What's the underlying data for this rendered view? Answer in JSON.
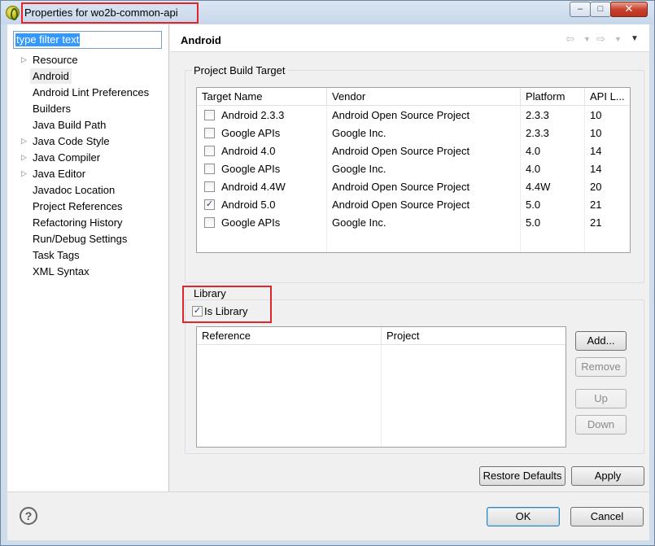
{
  "window": {
    "title": "Properties for wo2b-common-api",
    "minimize_glyph": "‒",
    "maximize_glyph": "□",
    "close_glyph": "✕"
  },
  "filter": {
    "value": "type filter text"
  },
  "tree": [
    {
      "label": "Resource",
      "expandable": true
    },
    {
      "label": "Android",
      "expandable": false,
      "selected": true
    },
    {
      "label": "Android Lint Preferences",
      "expandable": false
    },
    {
      "label": "Builders",
      "expandable": false
    },
    {
      "label": "Java Build Path",
      "expandable": false
    },
    {
      "label": "Java Code Style",
      "expandable": true
    },
    {
      "label": "Java Compiler",
      "expandable": true
    },
    {
      "label": "Java Editor",
      "expandable": true
    },
    {
      "label": "Javadoc Location",
      "expandable": false
    },
    {
      "label": "Project References",
      "expandable": false
    },
    {
      "label": "Refactoring History",
      "expandable": false
    },
    {
      "label": "Run/Debug Settings",
      "expandable": false
    },
    {
      "label": "Task Tags",
      "expandable": false
    },
    {
      "label": "XML Syntax",
      "expandable": false
    }
  ],
  "page": {
    "title": "Android",
    "back_icon": "back-arrow-icon",
    "forward_icon": "forward-arrow-icon",
    "menu_icon": "view-menu-icon"
  },
  "build_target": {
    "label": "Project Build Target",
    "columns": [
      "Target Name",
      "Vendor",
      "Platform",
      "API L..."
    ],
    "rows": [
      {
        "name": "Android 2.3.3",
        "vendor": "Android Open Source Project",
        "platform": "2.3.3",
        "api": "10",
        "checked": false
      },
      {
        "name": "Google APIs",
        "vendor": "Google Inc.",
        "platform": "2.3.3",
        "api": "10",
        "checked": false
      },
      {
        "name": "Android 4.0",
        "vendor": "Android Open Source Project",
        "platform": "4.0",
        "api": "14",
        "checked": false
      },
      {
        "name": "Google APIs",
        "vendor": "Google Inc.",
        "platform": "4.0",
        "api": "14",
        "checked": false
      },
      {
        "name": "Android 4.4W",
        "vendor": "Android Open Source Project",
        "platform": "4.4W",
        "api": "20",
        "checked": false
      },
      {
        "name": "Android 5.0",
        "vendor": "Android Open Source Project",
        "platform": "5.0",
        "api": "21",
        "checked": true
      },
      {
        "name": "Google APIs",
        "vendor": "Google Inc.",
        "platform": "5.0",
        "api": "21",
        "checked": false
      }
    ]
  },
  "library": {
    "label": "Library",
    "is_library_label": "Is Library",
    "is_library_checked": true,
    "columns": [
      "Reference",
      "Project"
    ],
    "buttons": {
      "add": "Add...",
      "remove": "Remove",
      "up": "Up",
      "down": "Down"
    }
  },
  "footer": {
    "restore_defaults": "Restore Defaults",
    "apply": "Apply",
    "ok": "OK",
    "cancel": "Cancel",
    "help_glyph": "?"
  }
}
